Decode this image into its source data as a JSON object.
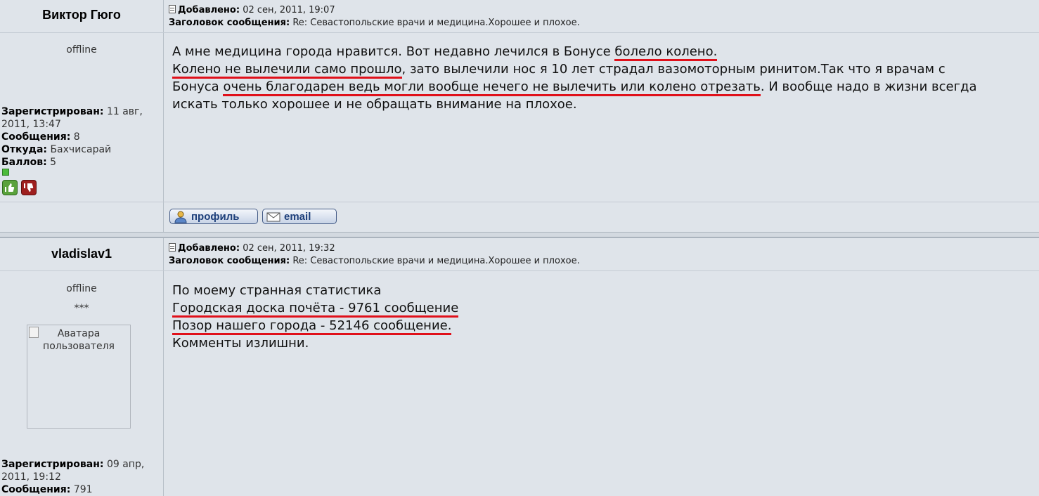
{
  "posts": [
    {
      "username": "Виктор Гюго",
      "added_label": "Добавлено:",
      "added_value": "02 сен, 2011, 19:07",
      "subject_label": "Заголовок сообщения:",
      "subject_value": "Re: Севастопольские врачи и медицина.Хорошее и плохое.",
      "status": "offline",
      "info": {
        "reg_label": "Зарегистрирован:",
        "reg_value": "11 авг,",
        "reg_value2": "2011, 13:47",
        "msgs_label": "Сообщения:",
        "msgs_value": "8",
        "from_label": "Откуда:",
        "from_value": "Бахчисарай",
        "points_label": "Баллов:",
        "points_value": "5"
      },
      "body": {
        "l1a": "А мне медицина города нравится. Вот недавно лечился в Бонусе ",
        "l1b": "болело колено.",
        "l2a": "Колено не вылечили само прошло",
        "l2b": ", зато вылечили нос я 10 лет страдал вазомоторным ринитом.Так что я врачам с",
        "l3a": "Бонуса ",
        "l3b": "очень благодарен ведь могли вообще нечего не вылечить или колено отрезать",
        "l3c": ". И вообще надо в жизни всегда",
        "l4": "искать только хорошее и не обращать внимание на плохое."
      },
      "buttons": {
        "profile": "профиль",
        "email": "email"
      }
    },
    {
      "username": "vladislav1",
      "added_label": "Добавлено:",
      "added_value": "02 сен, 2011, 19:32",
      "subject_label": "Заголовок сообщения:",
      "subject_value": "Re: Севастопольские врачи и медицина.Хорошее и плохое.",
      "status": "offline",
      "stars": "***",
      "avatar_alt": "Аватара пользователя",
      "info": {
        "reg_label": "Зарегистрирован:",
        "reg_value": "09 апр,",
        "reg_value2": "2011, 19:12",
        "msgs_label": "Сообщения:",
        "msgs_value": "791"
      },
      "body": {
        "l1": "По моему странная статистика",
        "l2": "Городская доска почёта - 9761 сообщение",
        "l3": "Позор нашего города - 52146 сообщение.",
        "l4": "Комменты излишни."
      }
    }
  ]
}
